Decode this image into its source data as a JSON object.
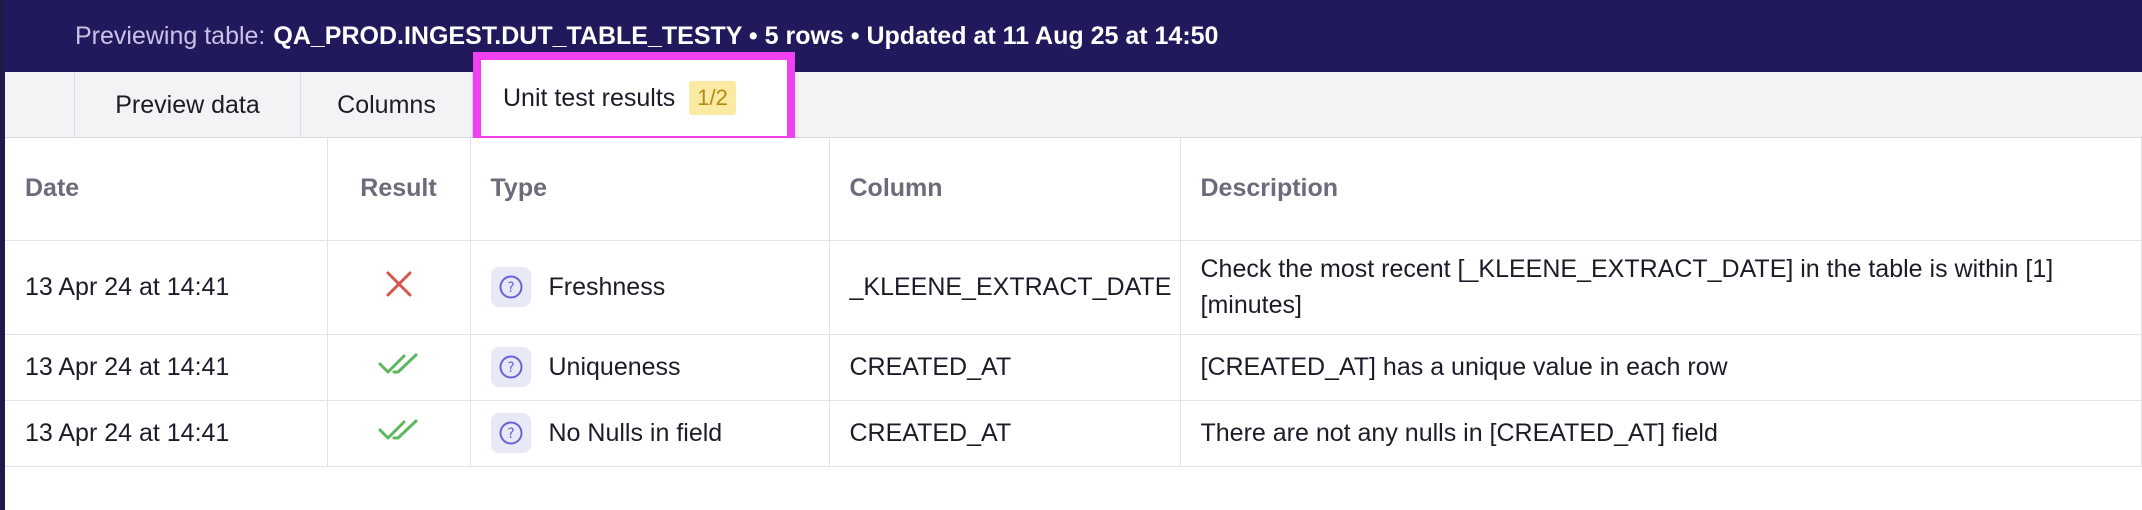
{
  "header": {
    "prefix": "Previewing table:",
    "summary": "QA_PROD.INGEST.DUT_TABLE_TESTY • 5 rows • Updated at 11 Aug 25 at 14:50"
  },
  "tabs": [
    {
      "label": "Preview data"
    },
    {
      "label": "Columns"
    },
    {
      "label": "Unit test results",
      "badge": "1/2"
    }
  ],
  "table": {
    "headers": [
      "Date",
      "Result",
      "Type",
      "Column",
      "Description"
    ],
    "rows": [
      {
        "date": "13 Apr 24 at 14:41",
        "result": "fail",
        "type": "Freshness",
        "column": "_KLEENE_EXTRACT_DATE",
        "description": "Check the most recent [_KLEENE_EXTRACT_DATE] in the table is within [1] [minutes]"
      },
      {
        "date": "13 Apr 24 at 14:41",
        "result": "pass",
        "type": "Uniqueness",
        "column": "CREATED_AT",
        "description": "[CREATED_AT] has a unique value in each row"
      },
      {
        "date": "13 Apr 24 at 14:41",
        "result": "pass",
        "type": "No Nulls in field",
        "column": "CREATED_AT",
        "description": "There are not any nulls in [CREATED_AT] field"
      }
    ]
  },
  "icons": {
    "fail": "cross-icon",
    "pass": "double-check-icon",
    "type": "question-circle-icon"
  },
  "colors": {
    "header_bg": "#201a5c",
    "highlight": "#f040f0",
    "fail": "#d9534f",
    "pass": "#5cb85c",
    "badge_bg": "#fbeaa3"
  }
}
